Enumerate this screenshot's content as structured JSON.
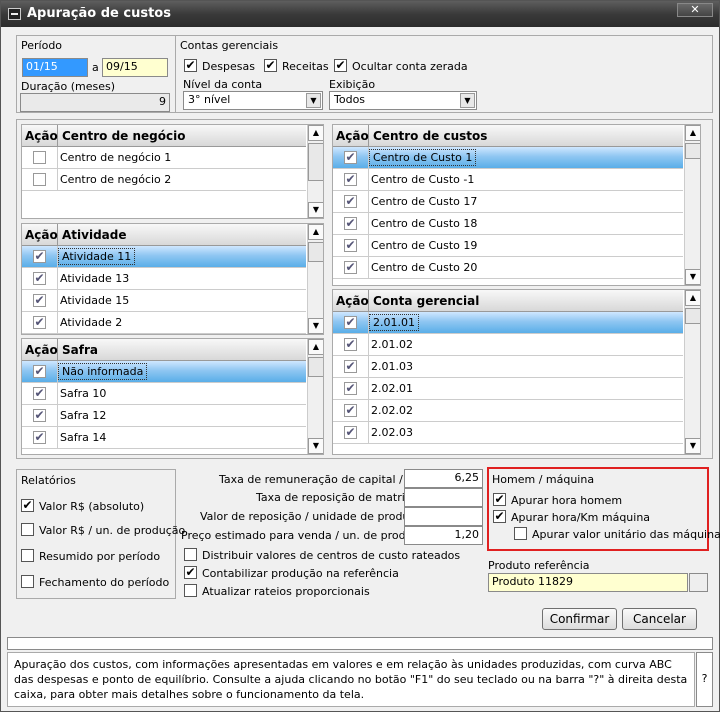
{
  "window": {
    "title": "Apuração de custos",
    "close_label": "✕"
  },
  "periodo": {
    "label": "Período",
    "from": "01/15",
    "sep": "a",
    "to": "09/15",
    "duracao_label": "Duração (meses)",
    "duracao": "9"
  },
  "contas": {
    "label": "Contas gerenciais",
    "despesas": "Despesas",
    "receitas": "Receitas",
    "ocultar": "Ocultar conta zerada",
    "nivel_label": "Nível da conta",
    "nivel_value": "3° nível",
    "exibicao_label": "Exibição",
    "exibicao_value": "Todos"
  },
  "lists": {
    "negocio": {
      "col1": "Ação",
      "col2": "Centro de negócio",
      "rows": [
        "Centro de negócio 1",
        "Centro de negócio 2"
      ]
    },
    "atividade": {
      "col1": "Ação",
      "col2": "Atividade",
      "rows": [
        "Atividade 11",
        "Atividade 13",
        "Atividade 15",
        "Atividade 2"
      ]
    },
    "safra": {
      "col1": "Ação",
      "col2": "Safra",
      "rows": [
        "Não informada",
        "Safra 10",
        "Safra 12",
        "Safra 14"
      ]
    },
    "custos": {
      "col1": "Ação",
      "col2": "Centro de custos",
      "rows": [
        "Centro de Custo 1",
        "Centro de Custo -1",
        "Centro de Custo 17",
        "Centro de Custo 18",
        "Centro de Custo 19",
        "Centro de Custo 20"
      ]
    },
    "conta": {
      "col1": "Ação",
      "col2": "Conta gerencial",
      "rows": [
        "2.01.01",
        "2.01.02",
        "2.01.03",
        "2.02.01",
        "2.02.02",
        "2.02.03"
      ]
    }
  },
  "relatorios": {
    "label": "Relatórios",
    "items": [
      "Valor R$ (absoluto)",
      "Valor R$ / un. de produção",
      "Resumido por período",
      "Fechamento do período"
    ]
  },
  "taxas": {
    "taxa_label": "Taxa de remuneração de capital / ano",
    "taxa_value": "6,25",
    "reposicao_label": "Taxa de reposição de matrizes",
    "reposicao_value": "",
    "valor_label": "Valor de reposição / unidade de produção",
    "valor_value": "",
    "preco_label": "Preço estimado para venda / un. de produção",
    "preco_value": "1,20"
  },
  "opcoes": {
    "distribuir": "Distribuir valores de centros de custo rateados",
    "contabilizar": "Contabilizar produção na referência",
    "atualizar": "Atualizar rateios proporcionais"
  },
  "homem": {
    "label": "Homem / máquina",
    "hora_homem": "Apurar hora homem",
    "hora_km": "Apurar hora/Km máquina",
    "valor_unit": "Apurar valor unitário das máquinas"
  },
  "produto": {
    "label": "Produto referência",
    "value": "Produto 11829"
  },
  "buttons": {
    "confirmar": "Confirmar",
    "cancelar": "Cancelar"
  },
  "help": {
    "text": "Apuração dos custos, com informações apresentadas em valores e em relação às unidades produzidas, com curva ABC das despesas e ponto de equilíbrio. Consulte a ajuda clicando no botão \"F1\" do seu teclado ou na barra \"?\" à direita desta caixa, para obter mais detalhes sobre o funcionamento da tela.",
    "q": "?"
  },
  "check": "✔"
}
